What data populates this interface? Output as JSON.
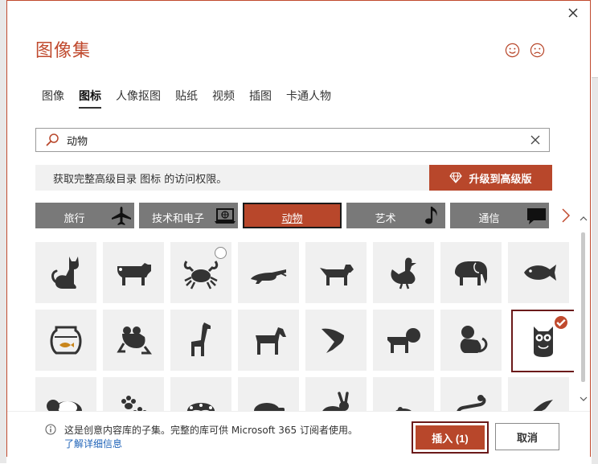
{
  "dialog": {
    "title": "图像集",
    "close_label": "close-icon"
  },
  "tabs": [
    {
      "label": "图像",
      "active": false
    },
    {
      "label": "图标",
      "active": true
    },
    {
      "label": "人像抠图",
      "active": false
    },
    {
      "label": "贴纸",
      "active": false
    },
    {
      "label": "视频",
      "active": false
    },
    {
      "label": "插图",
      "active": false
    },
    {
      "label": "卡通人物",
      "active": false
    }
  ],
  "search": {
    "value": "动物",
    "placeholder": ""
  },
  "upsell": {
    "text": "获取完整高级目录 图标 的访问权限。",
    "button_label": "升级到高级版"
  },
  "categories": [
    {
      "label": "旅行",
      "icon": "airplane-icon",
      "active": false
    },
    {
      "label": "技术和电子",
      "icon": "laptop-icon",
      "active": false
    },
    {
      "label": "动物",
      "icon": "",
      "active": true
    },
    {
      "label": "艺术",
      "icon": "music-note-icon",
      "active": false
    },
    {
      "label": "通信",
      "icon": "speech-bubble-icon",
      "active": false
    }
  ],
  "icons": [
    "cat-icon",
    "cow-icon",
    "crab-icon",
    "crocodile-icon",
    "dog-icon",
    "duck-icon",
    "elephant-icon",
    "fish-icon",
    "fishbowl-icon",
    "frog-icon",
    "giraffe-icon",
    "horse-icon",
    "hummingbird-icon",
    "lion-icon",
    "monkey-icon",
    "owl-icon",
    "panda-icon",
    "paw-prints-icon",
    "peacock-icon",
    "pig-icon",
    "rabbit-icon",
    "rat-icon",
    "snake-icon",
    "bird-icon"
  ],
  "selected_icon": "owl-icon",
  "footer": {
    "info_text": "这是创意内容库的子集。完整的库可供 Microsoft 365 订阅者使用。",
    "learn_more": "了解详细信息",
    "insert_label": "插入 (1)",
    "cancel_label": "取消"
  },
  "colors": {
    "accent": "#b8472b",
    "title": "#c04a2e",
    "tile_bg": "#f0f0f0",
    "icon_fill": "#333333"
  }
}
